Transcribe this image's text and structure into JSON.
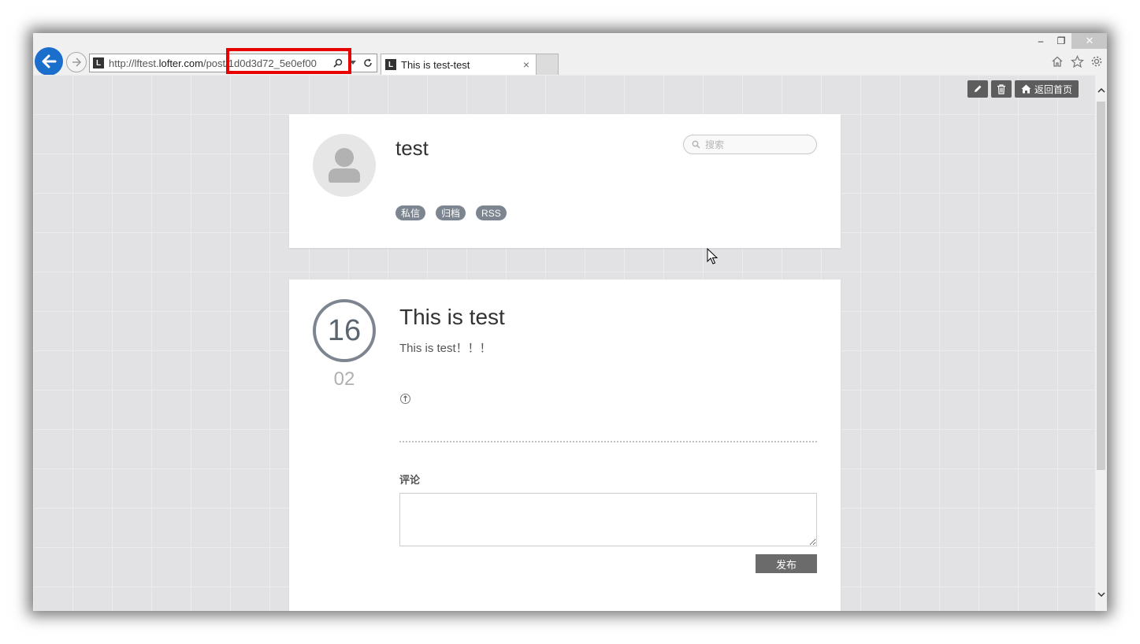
{
  "window": {
    "controls": {
      "minimize": "–",
      "maximize": "❐",
      "close": "✕"
    }
  },
  "browser": {
    "address": {
      "url_prefix": "http://lftest.",
      "url_domain": "lofter.com",
      "url_path": "/post/1d0d3d72_5e0ef00",
      "favicon": "L"
    },
    "tab": {
      "favicon": "L",
      "title": "This is test-test",
      "close": "×"
    },
    "toolbar_icons": [
      "home-icon",
      "star-icon",
      "gear-icon"
    ]
  },
  "page": {
    "top_buttons": {
      "home_label": "返回首页"
    },
    "profile": {
      "blog_name": "test",
      "search_placeholder": "搜索",
      "tags": [
        "私信",
        "归档",
        "RSS"
      ]
    },
    "post": {
      "day": "16",
      "month": "02",
      "title": "This is test",
      "body": "This is test！！！",
      "comment_label": "评论",
      "publish_label": "发布"
    }
  },
  "colors": {
    "accent_blue": "#1a6ecc",
    "highlight_red": "#e60000",
    "tag_gray": "#7d8690",
    "button_dark": "#5d5d5d"
  }
}
